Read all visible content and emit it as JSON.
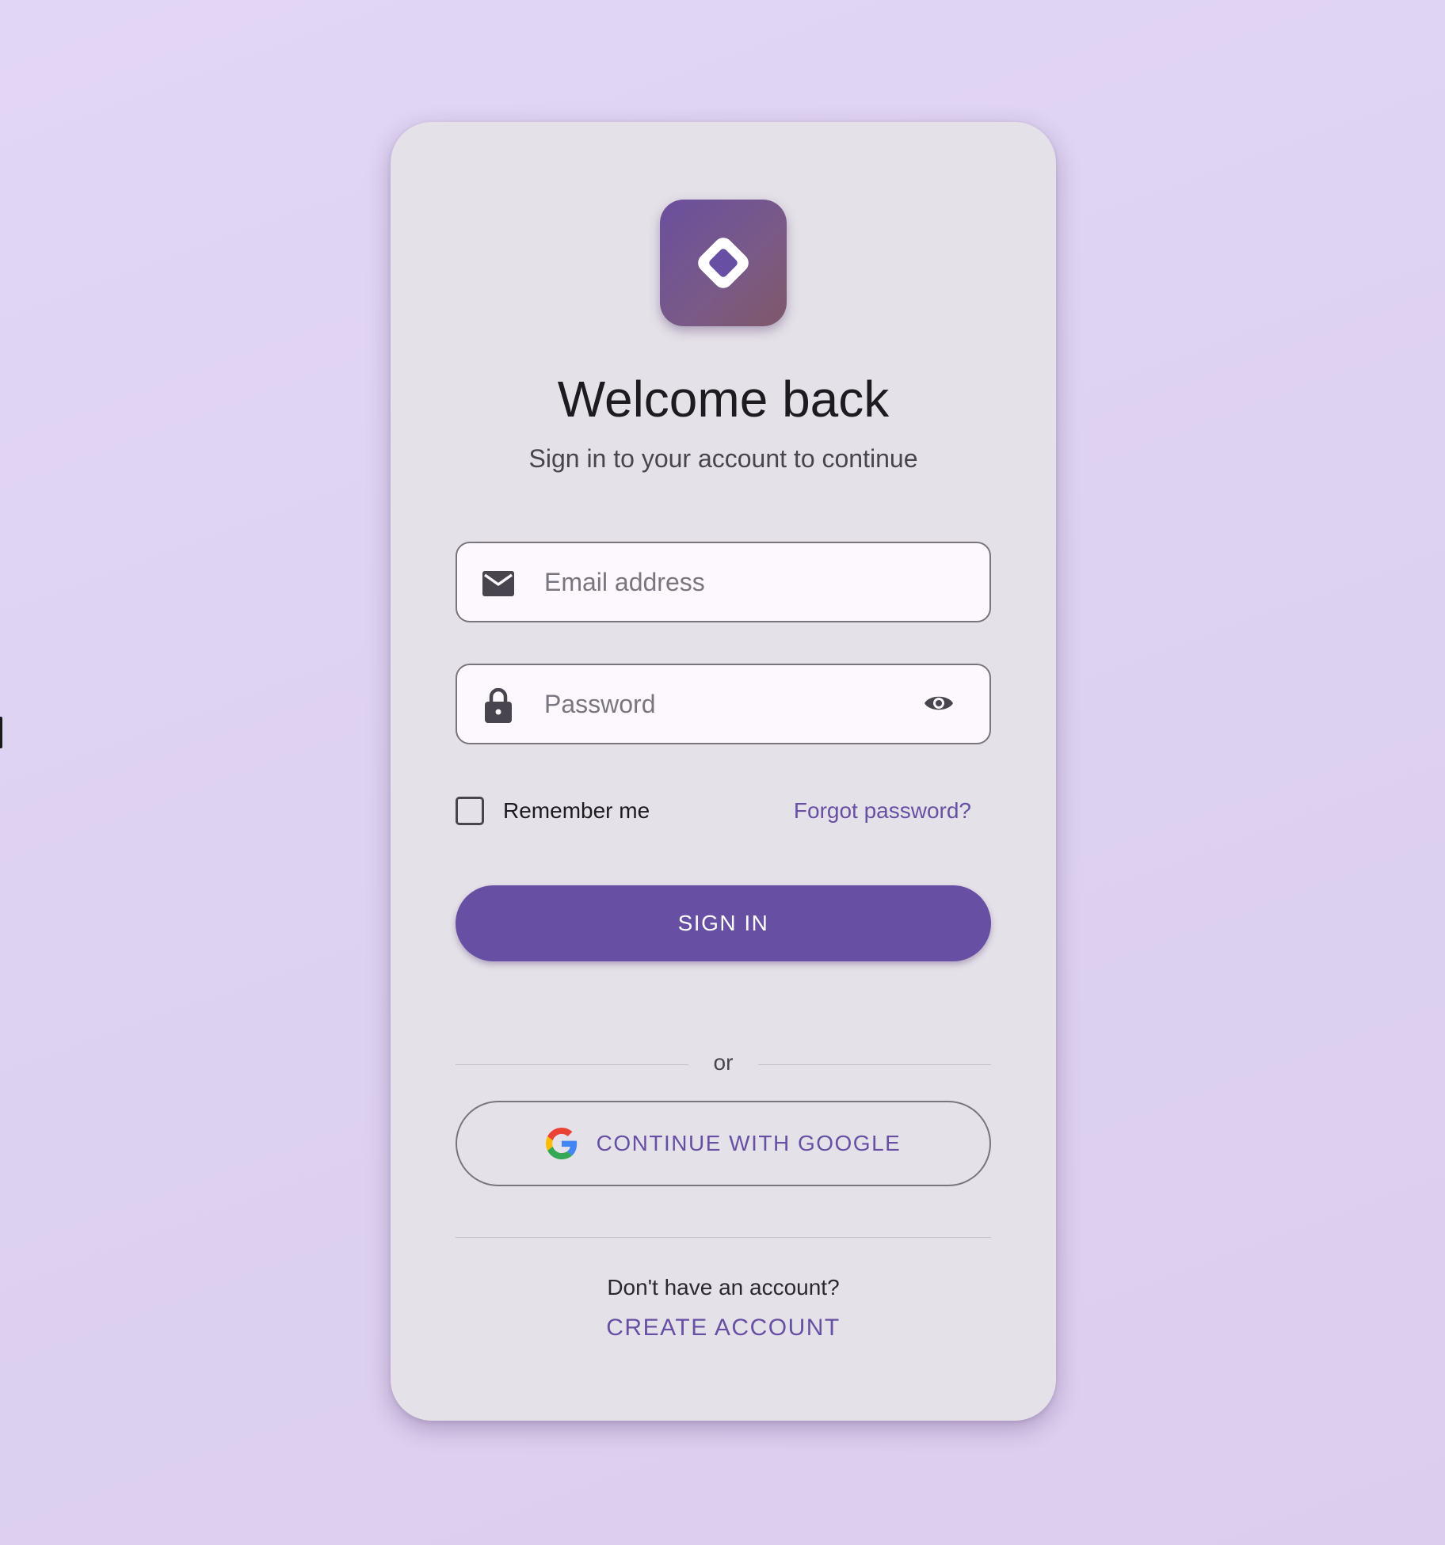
{
  "brand": {
    "logo_icon": "diamond-logo-icon",
    "accent_color": "#6750a4"
  },
  "header": {
    "title": "Welcome back",
    "subtitle": "Sign in to your account to continue"
  },
  "form": {
    "email": {
      "icon": "envelope-icon",
      "placeholder": "Email address",
      "value": ""
    },
    "password": {
      "icon": "lock-icon",
      "placeholder": "Password",
      "value": "",
      "toggle_icon": "eye-icon"
    },
    "remember_label": "Remember me",
    "remember_checked": false,
    "forgot_label": "Forgot password?",
    "signin_label": "SIGN IN"
  },
  "divider": {
    "label": "or"
  },
  "social": {
    "google_icon": "google-icon",
    "google_label": "CONTINUE WITH GOOGLE"
  },
  "footer": {
    "prompt": "Don't have an account?",
    "create_label": "CREATE ACCOUNT"
  }
}
